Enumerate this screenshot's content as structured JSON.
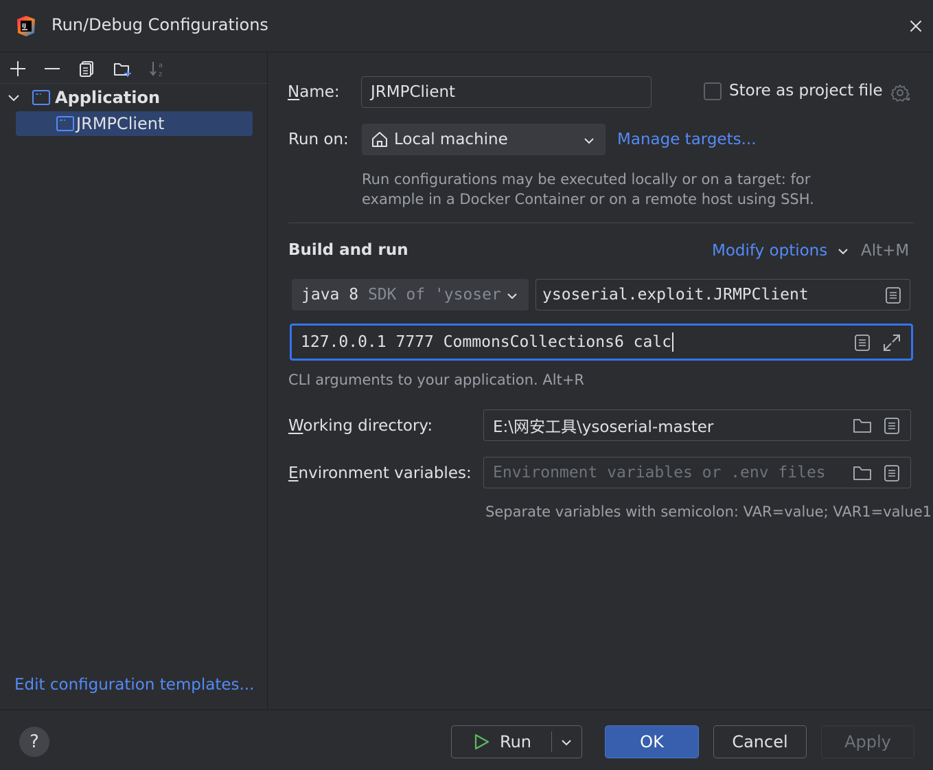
{
  "window": {
    "title": "Run/Debug Configurations"
  },
  "sidebar": {
    "tree": {
      "group_label": "Application",
      "items": [
        {
          "label": "JRMPClient",
          "selected": true
        }
      ]
    },
    "edit_templates_link": "Edit configuration templates..."
  },
  "form": {
    "name_label": "Name:",
    "name_value": "JRMPClient",
    "store_as_project_file_label": "Store as project file",
    "store_as_project_file_checked": false,
    "run_on_label": "Run on:",
    "run_on_value": "Local machine",
    "manage_targets_link": "Manage targets...",
    "run_on_hint_line1": "Run configurations may be executed locally or on a target: for",
    "run_on_hint_line2": "example in a Docker Container or on a remote host using SSH.",
    "build_and_run_title": "Build and run",
    "modify_options_link": "Modify options",
    "modify_options_shortcut": "Alt+M",
    "jdk_value_main": "java 8",
    "jdk_value_secondary": "SDK of 'ysoser",
    "main_class_value": "ysoserial.exploit.JRMPClient",
    "program_args_value": "127.0.0.1 7777 CommonsCollections6 calc",
    "program_args_hint": "CLI arguments to your application. Alt+R",
    "working_dir_label": "Working directory:",
    "working_dir_value": "E:\\网安工具\\ysoserial-master",
    "env_vars_label": "Environment variables:",
    "env_vars_placeholder": "Environment variables or .env files",
    "env_vars_hint": "Separate variables with semicolon: VAR=value; VAR1=value1"
  },
  "footer": {
    "help_label": "?",
    "run_label": "Run",
    "ok_label": "OK",
    "cancel_label": "Cancel",
    "apply_label": "Apply"
  },
  "colors": {
    "background": "#2b2d30",
    "accent": "#3574f0",
    "link": "#548af7",
    "selection": "#2e436e",
    "run_green": "#5fb865"
  }
}
